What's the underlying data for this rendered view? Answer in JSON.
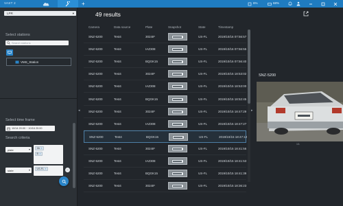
{
  "topbar": {
    "app_name": "VAST 2",
    "cpu": "6%",
    "ram": "68%",
    "accent": "#1f7cc1"
  },
  "sidebar": {
    "view_mode": "LPR",
    "select_stations_label": "Select stations",
    "search_placeholder": "Search stations",
    "station_name": "VMS_Station",
    "time_frame_label": "Select time frame",
    "date_range": "10/14 20:00 ~ 10/16 20:00",
    "search_criteria_label": "Search criteria",
    "criteria": [
      {
        "field": "plate",
        "chips": [
          "3A",
          "B"
        ]
      },
      {
        "field": "state",
        "chips": [
          "US-FL"
        ]
      }
    ]
  },
  "main": {
    "results_count": "49 results",
    "columns": [
      "Camera",
      "Data source",
      "Plate",
      "Snapshot",
      "State",
      "Timestamp"
    ],
    "rows": [
      {
        "camera": "SNZ-5200",
        "source": "Test4",
        "plate": "3024IF",
        "state": "US-FL",
        "timestamp": "2019/10/16 07:56:57"
      },
      {
        "camera": "SNZ-5200",
        "source": "Test4",
        "plate": "IAZ308",
        "state": "US-FL",
        "timestamp": "2019/10/16 07:56:55"
      },
      {
        "camera": "SNZ-5200",
        "source": "Test4",
        "plate": "BQGK15",
        "state": "US-FL",
        "timestamp": "2019/10/16 07:56:40"
      },
      {
        "camera": "SNZ-5200",
        "source": "Test4",
        "plate": "3024IF",
        "state": "US-FL",
        "timestamp": "2019/10/15 18:53:02"
      },
      {
        "camera": "SNZ-5200",
        "source": "Test4",
        "plate": "IAZ308",
        "state": "US-FL",
        "timestamp": "2019/10/15 18:53:00"
      },
      {
        "camera": "SNZ-5200",
        "source": "Test4",
        "plate": "BQGK15",
        "state": "US-FL",
        "timestamp": "2019/10/15 18:52:45"
      },
      {
        "camera": "SNZ-5200",
        "source": "Test4",
        "plate": "3024IF",
        "state": "US-FL",
        "timestamp": "2019/10/15 18:47:29"
      },
      {
        "camera": "SNZ-5200",
        "source": "Test4",
        "plate": "IAZ308",
        "state": "US-FL",
        "timestamp": "2019/10/15 18:47:27"
      },
      {
        "camera": "SNZ-5200",
        "source": "Test4",
        "plate": "BQGK15",
        "state": "US-FL",
        "timestamp": "2019/10/15 18:47:12"
      },
      {
        "camera": "SNZ-5200",
        "source": "Test4",
        "plate": "3024IF",
        "state": "US-FL",
        "timestamp": "2019/10/15 18:41:56"
      },
      {
        "camera": "SNZ-5200",
        "source": "Test4",
        "plate": "IAZ308",
        "state": "US-FL",
        "timestamp": "2019/10/15 18:41:53"
      },
      {
        "camera": "SNZ-5200",
        "source": "Test4",
        "plate": "BQGK15",
        "state": "US-FL",
        "timestamp": "2019/10/15 18:41:39"
      },
      {
        "camera": "SNZ-5200",
        "source": "Test4",
        "plate": "3024IF",
        "state": "US-FL",
        "timestamp": "2019/10/15 18:36:23"
      }
    ],
    "selected_row": 8
  },
  "preview": {
    "camera": "SNZ-5200",
    "page": "1/1"
  }
}
